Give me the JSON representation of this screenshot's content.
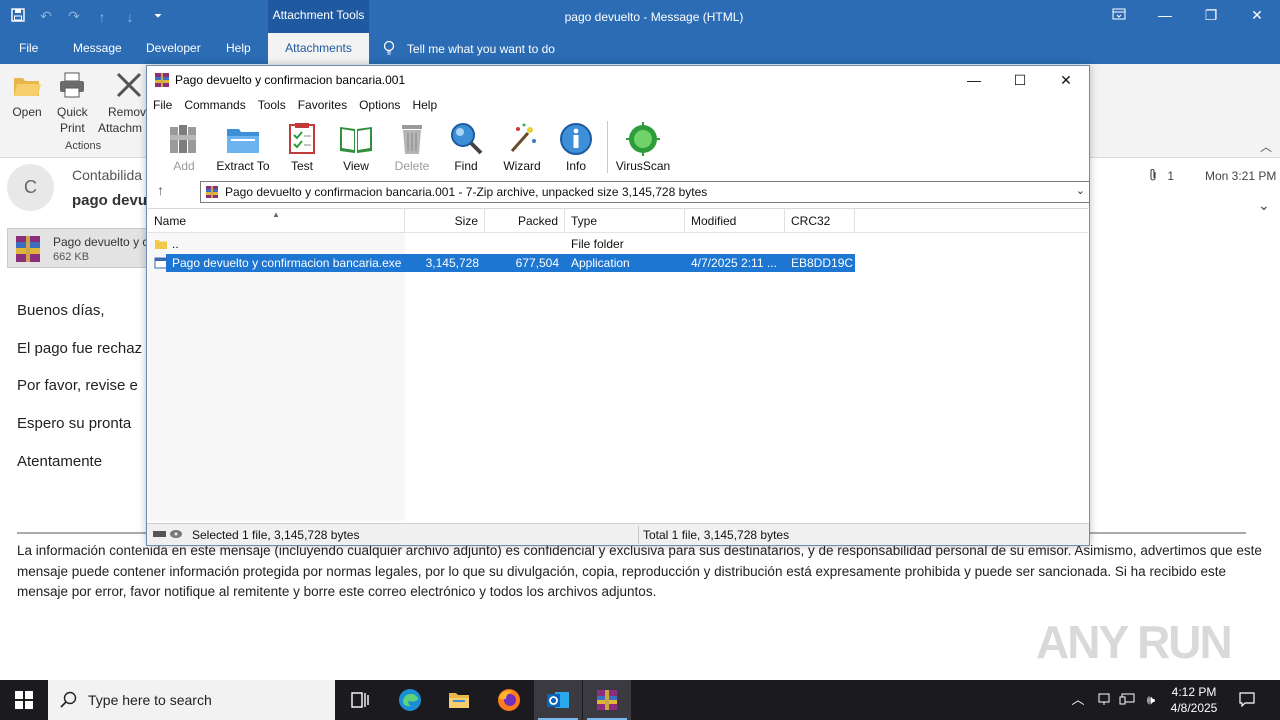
{
  "outlook": {
    "context_tab_group": "Attachment Tools",
    "title": "pago devuelto  -  Message (HTML)",
    "tabs": [
      "File",
      "Message",
      "Developer",
      "Help",
      "Attachments"
    ],
    "tell_me": "Tell me what you want to do",
    "ribbon": {
      "open": "Open",
      "quick_print_1": "Quick",
      "quick_print_2": "Print",
      "remove_1": "Remov",
      "remove_2": "Attachm",
      "group_actions": "Actions"
    },
    "message": {
      "avatar_initial": "C",
      "sender": "Contabilida",
      "subject": "pago devu",
      "attachment_count": "1",
      "date": "Mon 3:21 PM",
      "attachment_name": "Pago devuelto y c",
      "attachment_size": "662 KB",
      "body_lines": [
        "Buenos días,",
        "El pago fue rechaz",
        "Por favor, revise e",
        "Espero su pronta",
        "Atentamente"
      ],
      "disclaimer": "La información contenida en este mensaje (incluyendo cualquier archivo adjunto) es confidencial y exclusiva para sus destinatarios, y de responsabilidad personal de su emisor. Asimismo, advertimos que este mensaje puede contener información protegida por normas legales, por lo que su divulgación, copia, reproducción y distribución está expresamente prohibida y puede ser sancionada. Si ha recibido este mensaje por error, favor notifique al remitente y borre este correo electrónico y todos los archivos adjuntos."
    }
  },
  "winrar": {
    "title": "Pago devuelto y confirmacion bancaria.001",
    "menu": [
      "File",
      "Commands",
      "Tools",
      "Favorites",
      "Options",
      "Help"
    ],
    "toolbar": {
      "add": "Add",
      "extract_to": "Extract To",
      "test": "Test",
      "view": "View",
      "delete": "Delete",
      "find": "Find",
      "wizard": "Wizard",
      "info": "Info",
      "virusscan": "VirusScan"
    },
    "address": "Pago devuelto y confirmacion bancaria.001 - 7-Zip archive, unpacked size 3,145,728 bytes",
    "columns": [
      "Name",
      "Size",
      "Packed",
      "Type",
      "Modified",
      "CRC32"
    ],
    "rows": [
      {
        "name": "..",
        "size": "",
        "packed": "",
        "type": "File folder",
        "modified": "",
        "crc": ""
      },
      {
        "name": "Pago devuelto y confirmacion bancaria.exe",
        "size": "3,145,728",
        "packed": "677,504",
        "type": "Application",
        "modified": "4/7/2025 2:11 ...",
        "crc": "EB8DD19C"
      }
    ],
    "status_left": "Selected 1 file, 3,145,728 bytes",
    "status_right": "Total 1 file, 3,145,728 bytes"
  },
  "taskbar": {
    "search_placeholder": "Type here to search",
    "time": "4:12 PM",
    "date": "4/8/2025"
  },
  "watermark": "ANY RUN",
  "colors": {
    "outlook_blue": "#2b6cb5",
    "selection_blue": "#1c76d2",
    "taskbar": "#1b1b1f"
  }
}
